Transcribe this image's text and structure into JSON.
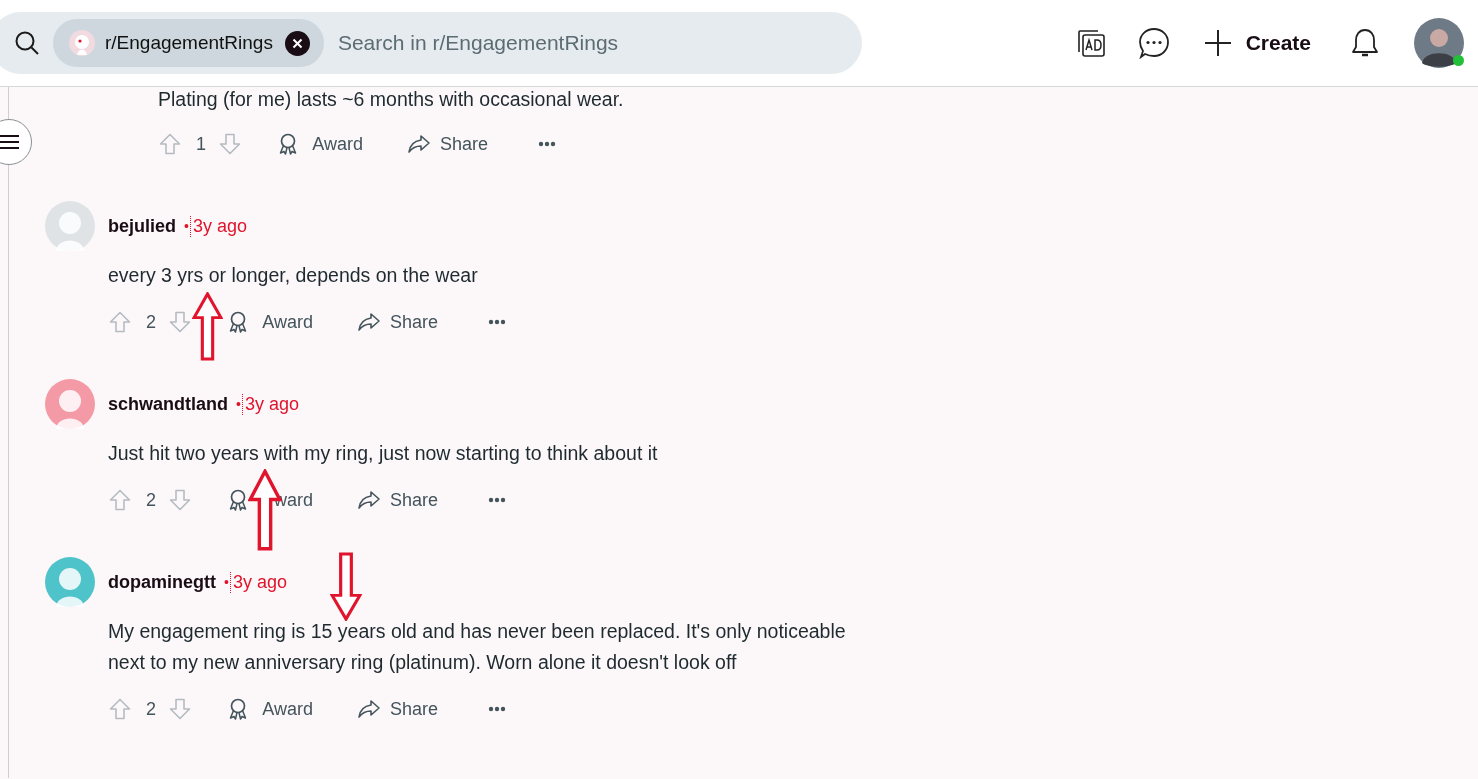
{
  "search": {
    "chip": "r/EngagementRings",
    "placeholder": "Search in r/EngagementRings"
  },
  "header_actions": {
    "create": "Create"
  },
  "profile": {
    "online": true
  },
  "partial_comment": {
    "body": "Plating (for me) lasts ~6 months with occasional wear.",
    "votes": "1",
    "award": "Award",
    "share": "Share"
  },
  "comments": [
    {
      "author": "bejulied",
      "separator": "•",
      "time": "3y ago",
      "color": "#dfe3e6",
      "body": "every 3 yrs or longer, depends on the wear",
      "votes": "2",
      "award": "Award",
      "share": "Share"
    },
    {
      "author": "schwandtland",
      "separator": "•",
      "time": "3y ago",
      "color": "#f39aa6",
      "body": "Just hit two years with my ring, just now starting to think about it",
      "votes": "2",
      "award": "ward",
      "share": "Share"
    },
    {
      "author": "dopaminegtt",
      "separator": "•",
      "time": "3y ago",
      "color": "#4ec3c9",
      "body": "My engagement ring is 15 years old and has never been replaced. It's only noticeable next to my new anniversary ring (platinum). Worn alone it doesn't look off",
      "votes": "2",
      "award": "Award",
      "share": "Share"
    }
  ],
  "annotations": [
    {
      "kind": "up"
    },
    {
      "kind": "up"
    },
    {
      "kind": "down"
    }
  ]
}
